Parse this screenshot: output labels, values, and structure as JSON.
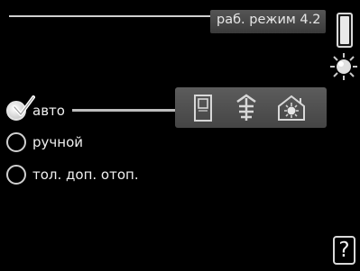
{
  "header": {
    "title": "раб. режим 4.2"
  },
  "options": [
    {
      "label": "авто",
      "checked": true
    },
    {
      "label": "ручной",
      "checked": false
    },
    {
      "label": "тол. доп. отоп.",
      "checked": false
    }
  ],
  "icons": {
    "side": "sun-icon",
    "panel": [
      "heat-pump-icon",
      "heat-exchanger-icon",
      "heating-sun-icon"
    ],
    "help": "help-icon"
  },
  "help": {
    "glyph": "?"
  },
  "colors": {
    "background": "#000000",
    "panel": "#505050",
    "text": "#f0f0f0"
  }
}
